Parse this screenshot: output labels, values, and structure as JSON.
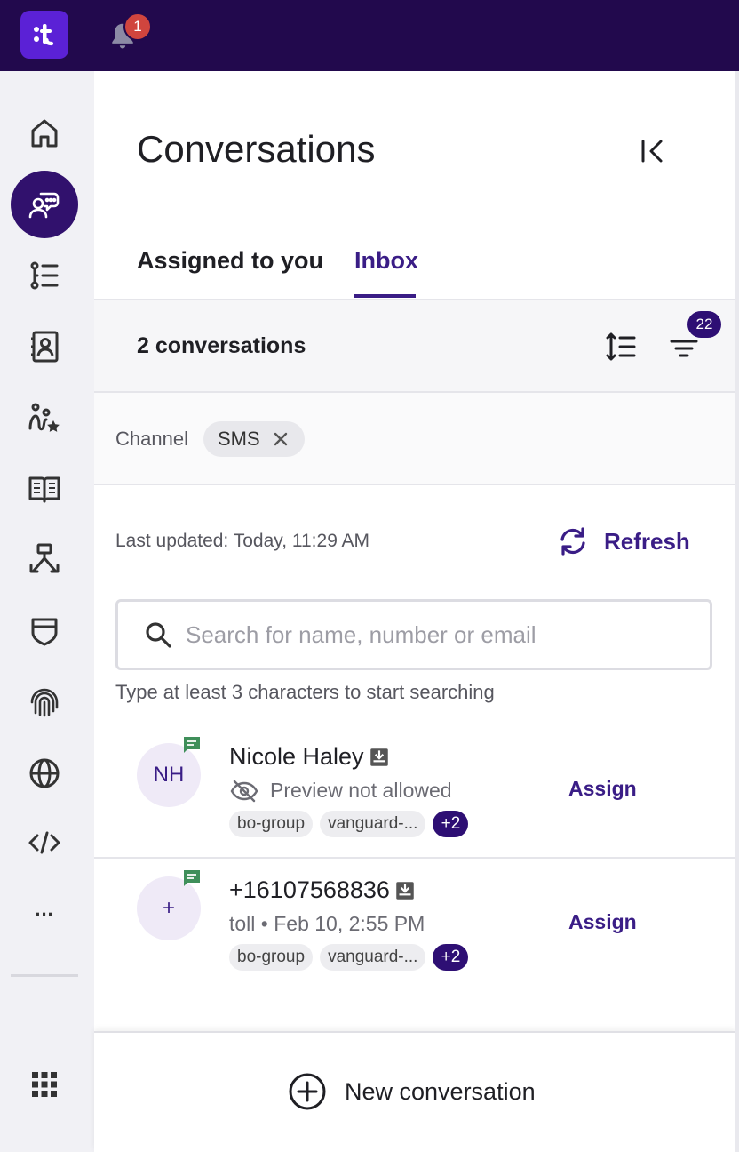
{
  "topbar": {
    "logo_text": ":t",
    "notification_count": "1"
  },
  "sidebar": {
    "items": [
      {
        "name": "home",
        "icon": "home-icon",
        "active": false
      },
      {
        "name": "conversations",
        "icon": "conversations-icon",
        "active": true
      },
      {
        "name": "lists",
        "icon": "list-icon",
        "active": false
      },
      {
        "name": "contacts",
        "icon": "contacts-icon",
        "active": false
      },
      {
        "name": "journeys",
        "icon": "journey-icon",
        "active": false
      },
      {
        "name": "knowledge",
        "icon": "book-icon",
        "active": false
      },
      {
        "name": "flows",
        "icon": "flow-icon",
        "active": false
      },
      {
        "name": "security",
        "icon": "shield-icon",
        "active": false
      },
      {
        "name": "identity",
        "icon": "fingerprint-icon",
        "active": false
      },
      {
        "name": "web",
        "icon": "globe-icon",
        "active": false
      },
      {
        "name": "developer",
        "icon": "code-icon",
        "active": false
      }
    ],
    "more_label": "...",
    "apps_icon": "apps-grid-icon"
  },
  "panel": {
    "title": "Conversations",
    "tabs": [
      {
        "label": "Assigned to you",
        "active": false
      },
      {
        "label": "Inbox",
        "active": true
      }
    ],
    "count_text": "2 conversations",
    "filter_count": "22",
    "filter": {
      "label": "Channel",
      "chip": "SMS"
    },
    "last_updated": "Last updated: Today, 11:29 AM",
    "refresh_label": "Refresh",
    "search": {
      "placeholder": "Search for name, number or email",
      "hint": "Type at least 3 characters to start searching"
    },
    "conversations": [
      {
        "avatar": "NH",
        "name": "Nicole Haley",
        "sub": "Preview not allowed",
        "sub_has_hidden_icon": true,
        "tags": [
          "bo-group",
          "vanguard-..."
        ],
        "more_tags": "+2",
        "action": "Assign"
      },
      {
        "avatar": "+",
        "name": "+16107568836",
        "sub": "toll • Feb 10, 2:55 PM",
        "sub_has_hidden_icon": false,
        "tags": [
          "bo-group",
          "vanguard-..."
        ],
        "more_tags": "+2",
        "action": "Assign"
      }
    ],
    "new_conversation_label": "New conversation"
  },
  "colors": {
    "topbar": "#22094d",
    "brand": "#5b21d6",
    "accent": "#3a1d86",
    "badge_red": "#d0453e",
    "sms_green": "#3f8f5a"
  }
}
